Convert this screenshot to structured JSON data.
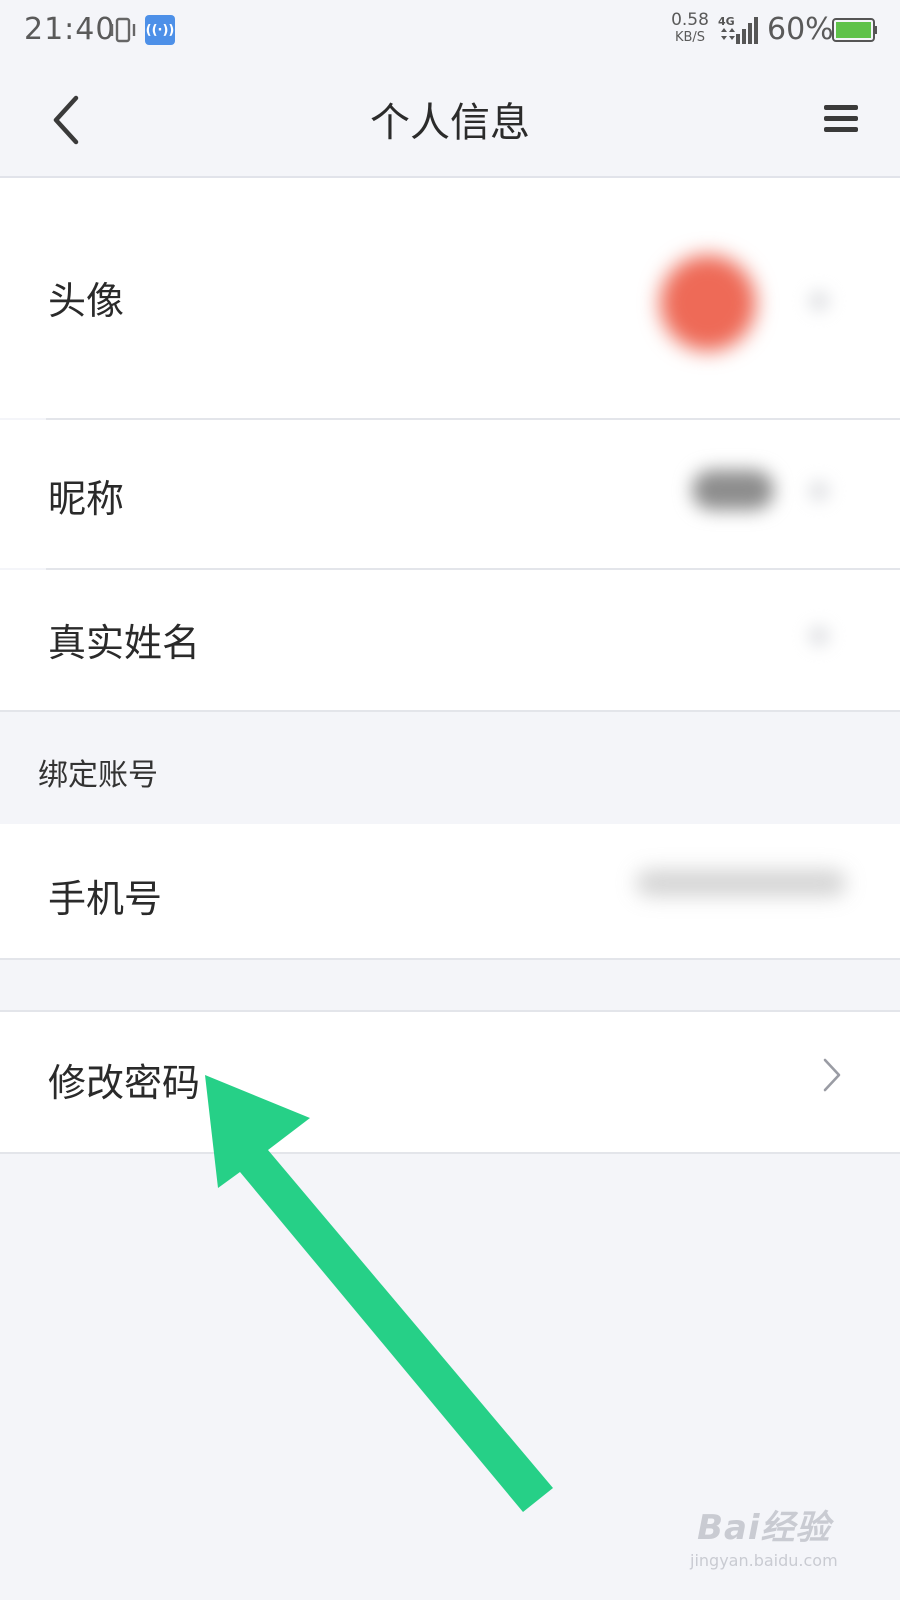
{
  "status_bar": {
    "time": "21:40",
    "net_speed_value": "0.58",
    "net_speed_unit": "KB/S",
    "network_type": "4G",
    "battery_percent": "60%",
    "hotspot_icon": "hotspot-icon",
    "battery_color": "#5fc24a"
  },
  "nav": {
    "title": "个人信息",
    "back_icon": "chevron-left-icon",
    "menu_icon": "menu-icon"
  },
  "rows": {
    "avatar": "头像",
    "nickname": "昵称",
    "real_name": "真实姓名",
    "section_bind": "绑定账号",
    "phone": "手机号",
    "change_password": "修改密码"
  },
  "annotation": {
    "arrow_color": "#26d087"
  },
  "watermark": {
    "main": "Bai经验",
    "sub": "jingyan.baidu.com"
  }
}
